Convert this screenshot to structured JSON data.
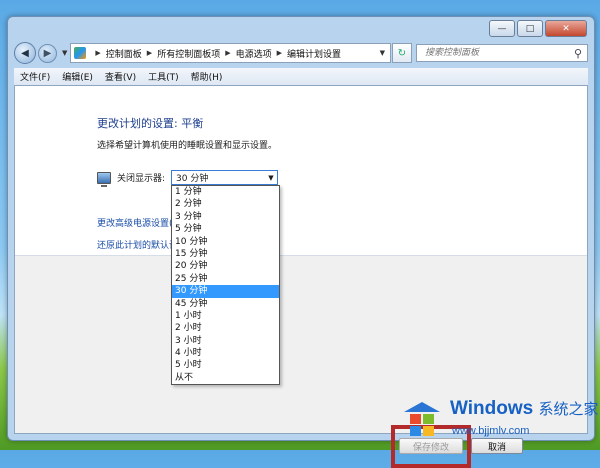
{
  "window": {
    "caption_buttons": {
      "minimize": "—",
      "maximize": "□",
      "close": "✕"
    }
  },
  "nav": {
    "breadcrumbs": [
      "控制面板",
      "所有控制面板项",
      "电源选项",
      "编辑计划设置"
    ],
    "search_placeholder": "搜索控制面板"
  },
  "menu": [
    "文件(F)",
    "编辑(E)",
    "查看(V)",
    "工具(T)",
    "帮助(H)"
  ],
  "content": {
    "title": "更改计划的设置: 平衡",
    "subtitle": "选择希望计算机使用的睡眠设置和显示设置。",
    "display_off_label": "关闭显示器:",
    "display_off_value": "30 分钟",
    "link_advanced": "更改高级电源设置(C)",
    "link_restore": "还原此计划的默认设置",
    "save_button": "保存修改",
    "cancel_button": "取消"
  },
  "dropdown": {
    "options": [
      "1 分钟",
      "2 分钟",
      "3 分钟",
      "5 分钟",
      "10 分钟",
      "15 分钟",
      "20 分钟",
      "25 分钟",
      "30 分钟",
      "45 分钟",
      "1 小时",
      "2 小时",
      "3 小时",
      "4 小时",
      "5 小时",
      "从不"
    ],
    "selected_index": 8
  },
  "watermark": {
    "brand": "Windows",
    "brand_cn": "系统之家",
    "url": "www.bjjmlv.com"
  },
  "colors": {
    "accent": "#3399ff",
    "link": "#1a4ea8",
    "highlight_box": "#b22a2a"
  }
}
